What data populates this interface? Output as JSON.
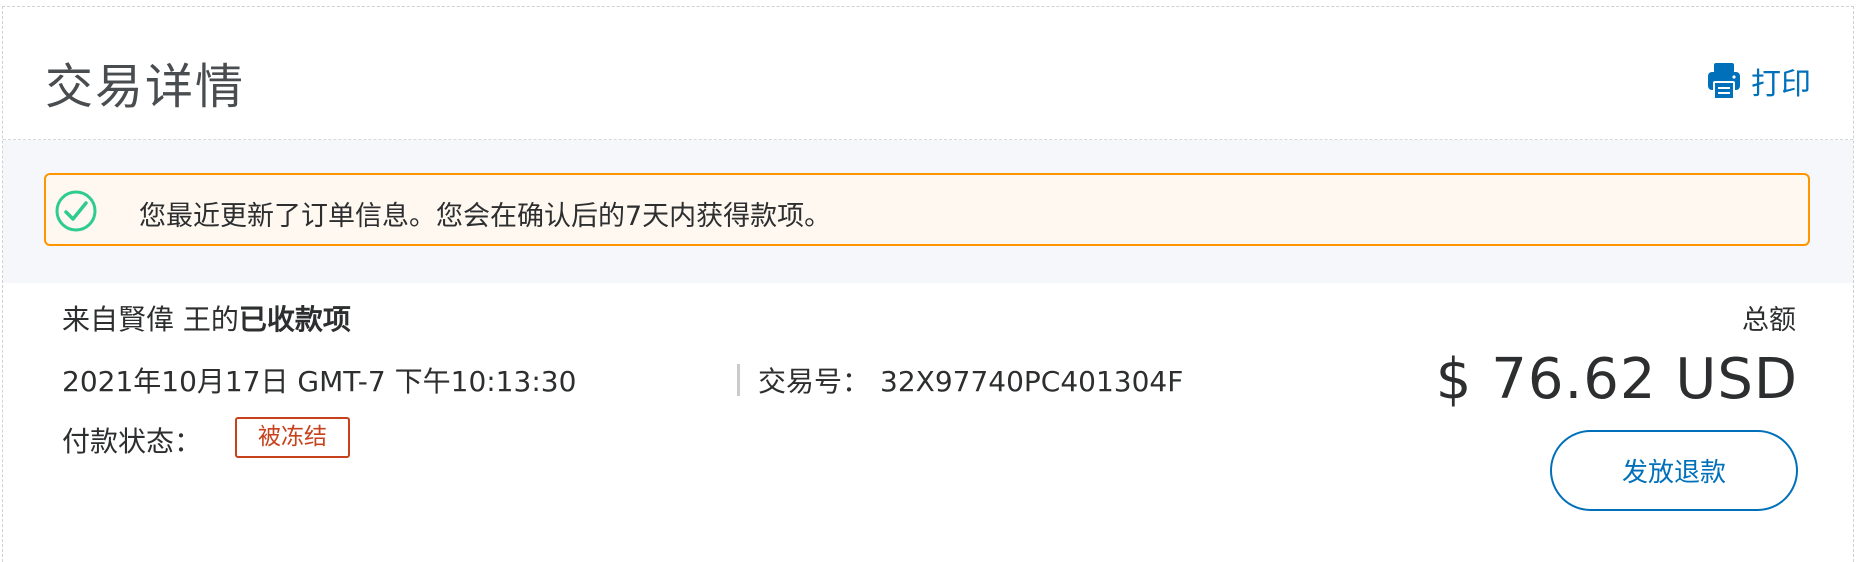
{
  "header": {
    "title": "交易详情",
    "print_label": "打印"
  },
  "notice": {
    "icon": "check-circle-icon",
    "text": "您最近更新了订单信息。您会在确认后的7天内获得款项。"
  },
  "transaction": {
    "from_prefix": "来自賢偉 王的",
    "from_bold": "已收款项",
    "datetime": "2021年10月17日 GMT-7 下午10:13:30",
    "txn_label": "交易号：",
    "txn_id": "32X97740PC401304F",
    "status_label": "付款状态：",
    "status_value": "被冻结",
    "total_label": "总额",
    "amount": "$ 76.62 USD",
    "refund_label": "发放退款"
  },
  "colors": {
    "link_blue": "#0070ba",
    "warning_border": "#ff9600",
    "success_green": "#2ecc8f",
    "status_red": "#c7421c"
  }
}
